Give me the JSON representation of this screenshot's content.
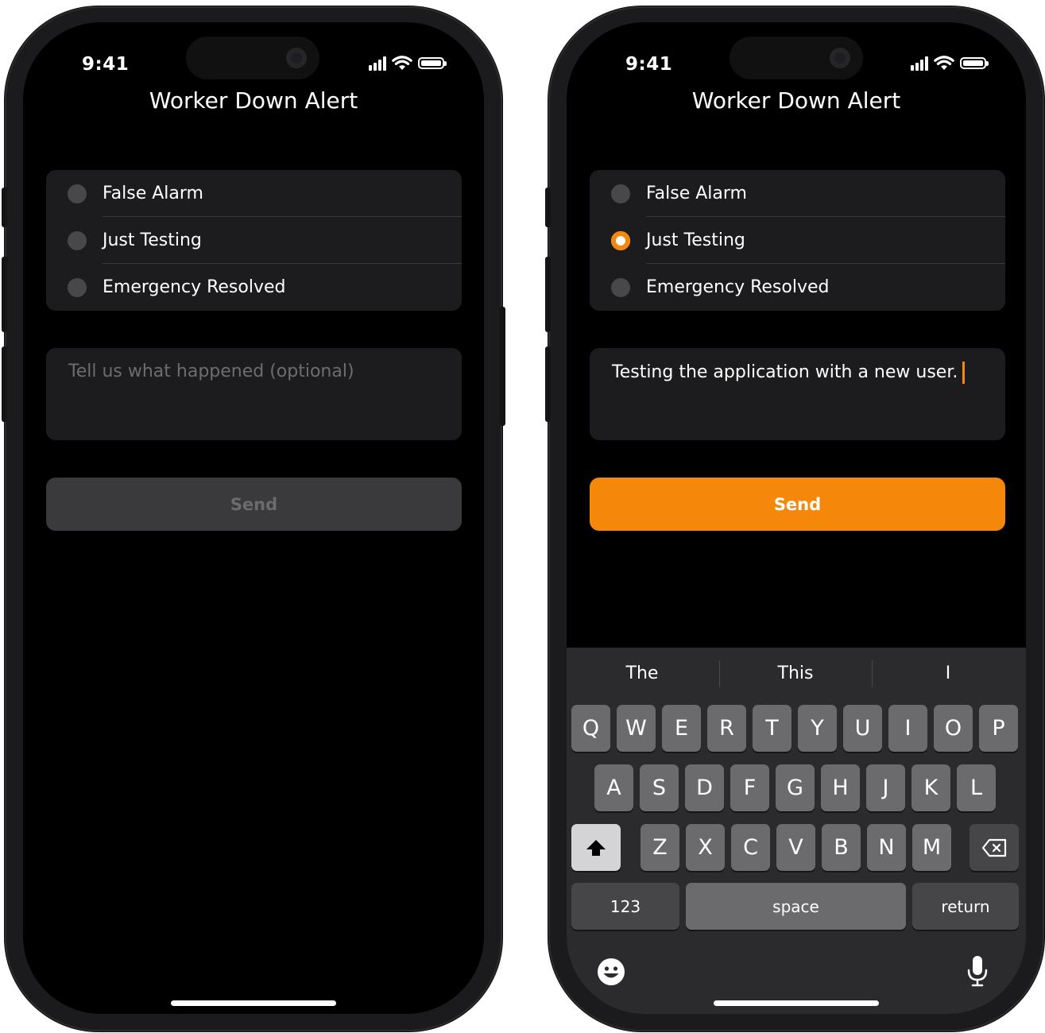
{
  "colors": {
    "accent": "#f5880b",
    "background": "#000000",
    "card": "#1c1c1e",
    "disabled_button": "#3a3a3c"
  },
  "left_phone": {
    "status": {
      "time": "9:41"
    },
    "title": "Worker Down Alert",
    "options": [
      {
        "label": "False Alarm",
        "selected": false
      },
      {
        "label": "Just Testing",
        "selected": false
      },
      {
        "label": "Emergency Resolved",
        "selected": false
      }
    ],
    "textbox": {
      "placeholder": "Tell us what happened (optional)",
      "value": ""
    },
    "send_label": "Send",
    "send_enabled": false
  },
  "right_phone": {
    "status": {
      "time": "9:41"
    },
    "title": "Worker Down Alert",
    "options": [
      {
        "label": "False Alarm",
        "selected": false
      },
      {
        "label": "Just Testing",
        "selected": true
      },
      {
        "label": "Emergency Resolved",
        "selected": false
      }
    ],
    "textbox": {
      "placeholder": "Tell us what happened (optional)",
      "value": "Testing the application with a new user."
    },
    "send_label": "Send",
    "send_enabled": true,
    "keyboard": {
      "suggestions": [
        "The",
        "This",
        "I"
      ],
      "row1": [
        "Q",
        "W",
        "E",
        "R",
        "T",
        "Y",
        "U",
        "I",
        "O",
        "P"
      ],
      "row2": [
        "A",
        "S",
        "D",
        "F",
        "G",
        "H",
        "J",
        "K",
        "L"
      ],
      "row3": [
        "Z",
        "X",
        "C",
        "V",
        "B",
        "N",
        "M"
      ],
      "numbers_label": "123",
      "space_label": "space",
      "return_label": "return",
      "icons": [
        "shift-icon",
        "backspace-icon",
        "emoji-icon",
        "microphone-icon"
      ]
    }
  }
}
